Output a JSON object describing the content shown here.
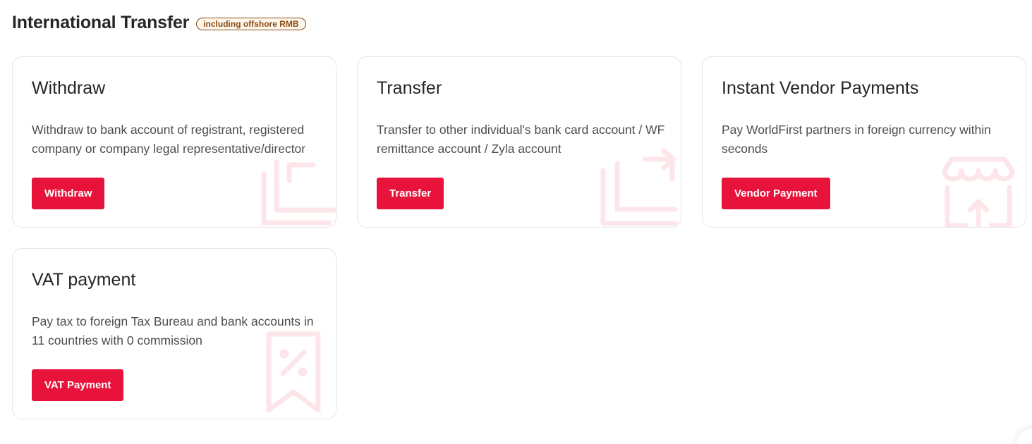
{
  "header": {
    "title": "International Transfer",
    "badge": "including offshore RMB"
  },
  "colors": {
    "accent": "#e8133a",
    "badge_text": "#8a4a12"
  },
  "cards": [
    {
      "title": "Withdraw",
      "description": "Withdraw to bank account of registrant, registered company or company legal representative/director",
      "button": "Withdraw",
      "icon": "withdraw-icon"
    },
    {
      "title": "Transfer",
      "description": "Transfer to other individual's bank card account / WF remittance account / Zyla account",
      "button": "Transfer",
      "icon": "transfer-icon"
    },
    {
      "title": "Instant Vendor Payments",
      "description": "Pay WorldFirst partners in foreign currency within seconds",
      "button": "Vendor Payment",
      "icon": "shop-upload-icon"
    },
    {
      "title": "VAT payment",
      "description": "Pay tax to foreign Tax Bureau and bank accounts in 11 countries with 0 commission",
      "button": "VAT Payment",
      "icon": "tax-receipt-icon"
    }
  ]
}
